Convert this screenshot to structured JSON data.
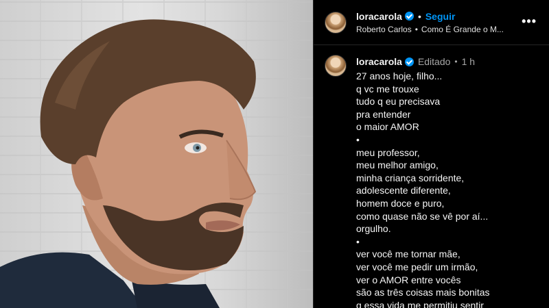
{
  "post": {
    "username": "loracarola",
    "follow_label": "Seguir",
    "audio_artist": "Roberto Carlos",
    "audio_title": "Como É Grande o M...",
    "more_label": "•••",
    "separator": "•",
    "edited_label": "Editado",
    "time_ago": "1 h"
  },
  "caption": {
    "lines": [
      "27 anos hoje, filho...",
      "q vc me trouxe",
      "tudo q eu precisava",
      "pra entender",
      "o maior AMOR",
      "•",
      "meu professor,",
      "meu melhor amigo,",
      "minha criança sorridente,",
      "adolescente diferente,",
      "homem doce e puro,",
      "como quase não se vê por aí...",
      "orgulho.",
      "•",
      "ver você me tornar mãe,",
      "ver você me pedir um irmão,",
      "ver o AMOR entre vocês",
      "são as três coisas mais bonitas",
      "q essa vida me permitiu sentir"
    ]
  },
  "colors": {
    "accent": "#0095f6",
    "background": "#000000",
    "muted": "#a8a8a8"
  }
}
